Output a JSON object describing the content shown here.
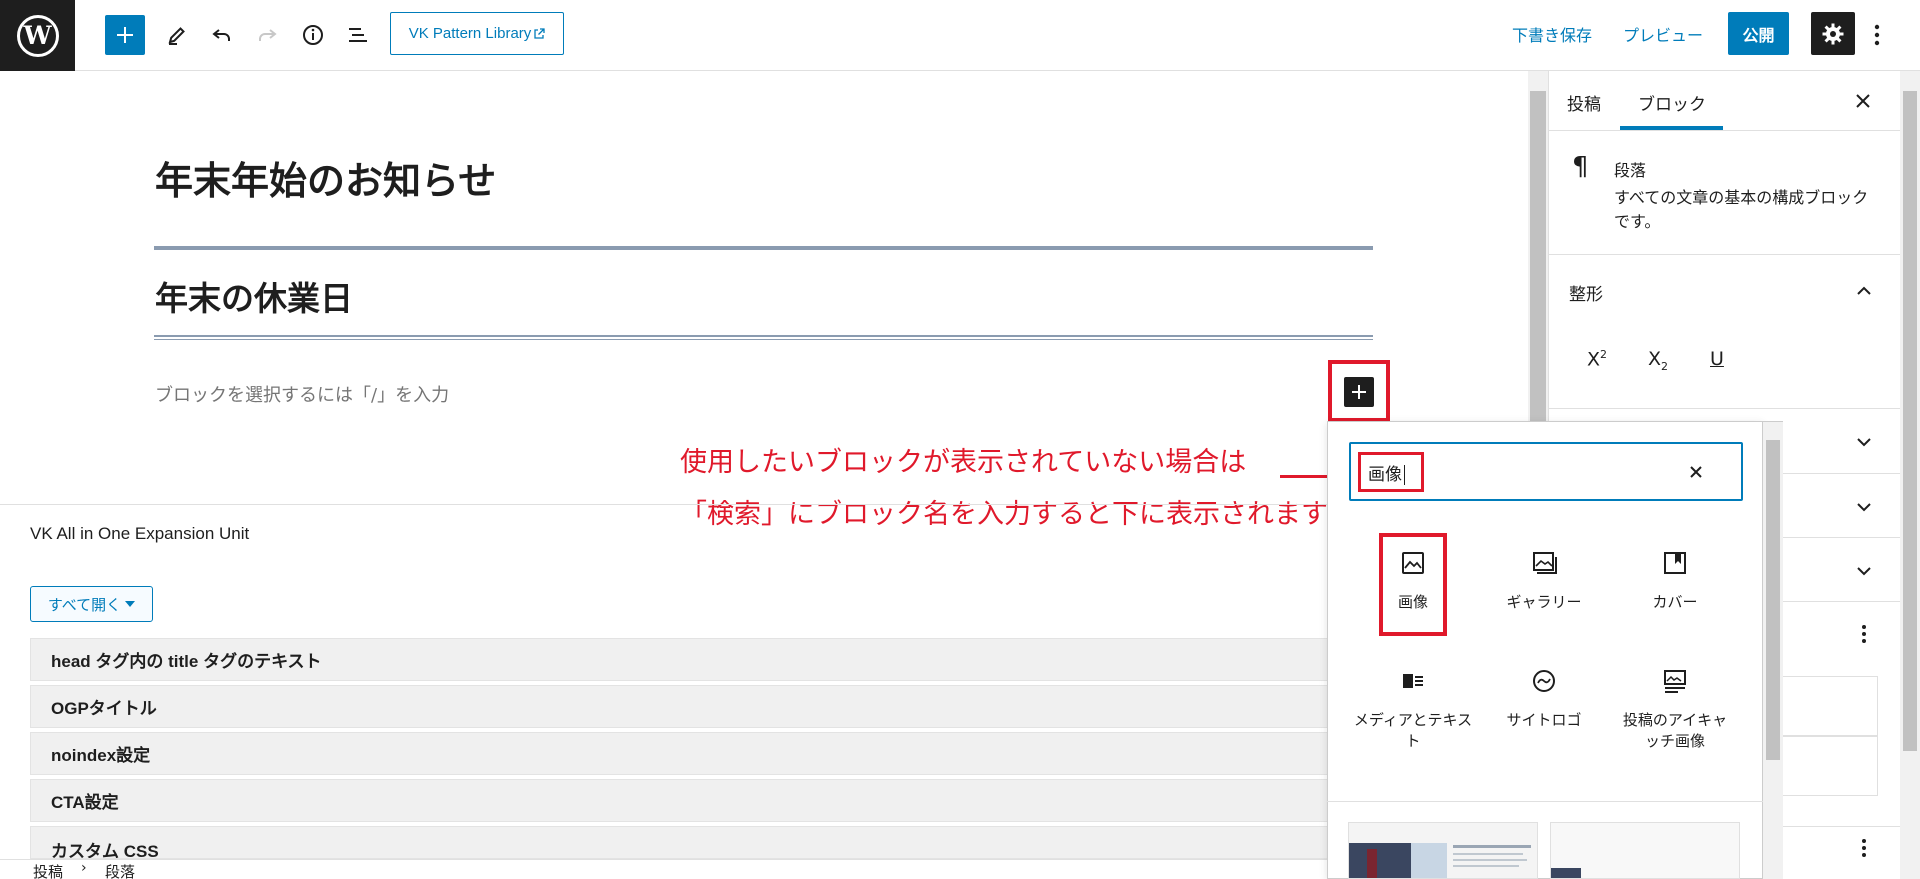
{
  "toolbar": {
    "pattern_library_label": "VK Pattern Library",
    "save_draft_label": "下書き保存",
    "preview_label": "プレビュー",
    "publish_label": "公開"
  },
  "editor": {
    "post_title": "年末年始のお知らせ",
    "heading_2": "年末の休業日",
    "paragraph_placeholder": "ブロックを選択するには「/」を入力"
  },
  "annotation": {
    "line_1": "使用したいブロックが表示されていない場合は",
    "line_2": "「検索」にブロック名を入力すると下に表示されます"
  },
  "inserter": {
    "search_value": "画像",
    "blocks": [
      {
        "label": "画像",
        "icon": "image-icon"
      },
      {
        "label": "ギャラリー",
        "icon": "gallery-icon"
      },
      {
        "label": "カバー",
        "icon": "cover-icon"
      },
      {
        "label": "メディアとテキスト",
        "icon": "media-text-icon"
      },
      {
        "label": "サイトロゴ",
        "icon": "site-logo-icon"
      },
      {
        "label": "投稿のアイキャッチ画像",
        "icon": "featured-image-icon"
      }
    ]
  },
  "metabox": {
    "title": "VK All in One Expansion Unit",
    "open_all_label": "すべて開く",
    "rows": [
      "head タグ内の title タグのテキスト",
      "OGPタイトル",
      "noindex設定",
      "CTA設定",
      "カスタム CSS"
    ]
  },
  "statusbar": {
    "breadcrumb": [
      "投稿",
      "段落"
    ]
  },
  "sidebar": {
    "tabs": [
      "投稿",
      "ブロック"
    ],
    "active_tab": "ブロック",
    "block_name": "段落",
    "block_description": "すべての文章の基本の構成ブロックです。",
    "panel_title": "整形",
    "format_buttons": [
      "X²",
      "X₂",
      "U"
    ]
  },
  "colors": {
    "accent": "#007cba",
    "annotation_red": "#e0192b",
    "dark": "#1e1e1e"
  }
}
